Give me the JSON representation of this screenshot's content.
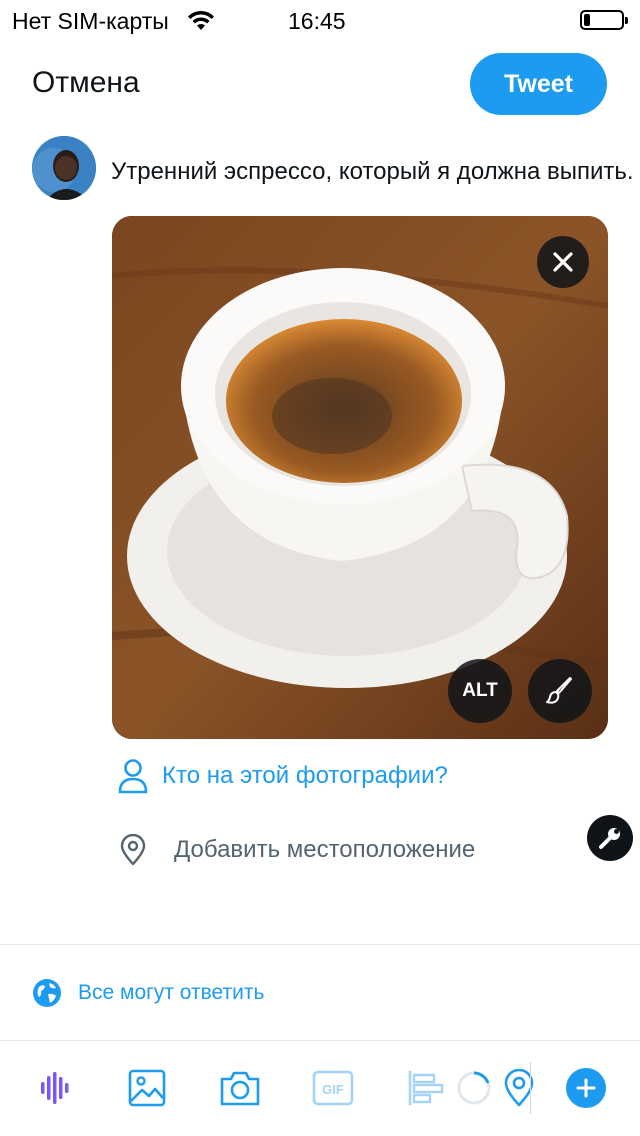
{
  "status_bar": {
    "carrier": "Нет SIM-карты",
    "time": "16:45"
  },
  "header": {
    "cancel_label": "Отмена",
    "tweet_label": "Tweet"
  },
  "compose": {
    "text": "Утренний эспрессо, который я должна выпить."
  },
  "media": {
    "alt_label": "ALT"
  },
  "actions": {
    "tag_people_label": "Кто на этой фотографии?",
    "add_location_label": "Добавить местоположение"
  },
  "reply_settings": {
    "label": "Все могут ответить"
  },
  "toolbar": {
    "gif_label": "GIF"
  },
  "icons": {
    "wifi": "wifi-icon",
    "battery": "battery-icon",
    "close": "close-icon",
    "edit": "brush-icon",
    "person": "person-icon",
    "location": "location-pin-icon",
    "wrench": "wrench-icon",
    "globe": "globe-icon",
    "audio": "voice-wave-icon",
    "image": "image-icon",
    "camera": "camera-icon",
    "gif": "gif-icon",
    "poll": "poll-icon",
    "add": "plus-icon"
  },
  "colors": {
    "accent": "#1d9bf0",
    "text_primary": "#0f1419",
    "text_secondary": "#536471",
    "audio_purple": "#7856ff"
  }
}
